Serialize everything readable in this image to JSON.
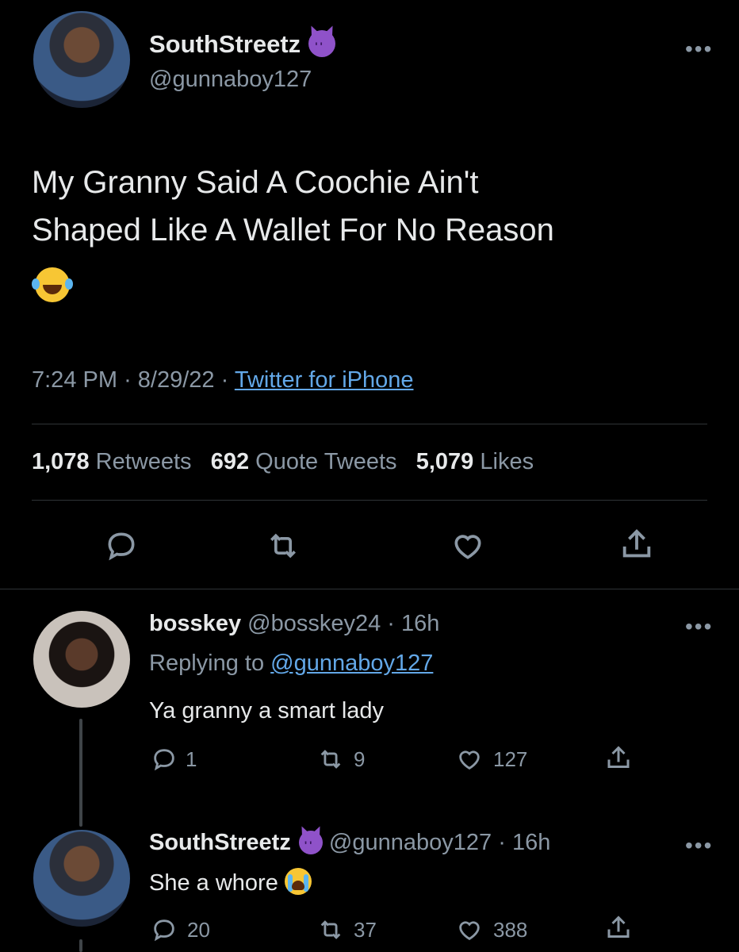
{
  "main_tweet": {
    "display_name": "SouthStreetz",
    "handle": "@gunnaboy127",
    "text_line1": "My Granny Said A Coochie Ain't",
    "text_line2": "Shaped Like A Wallet For No Reason",
    "time": "7:24 PM",
    "date": "8/29/22",
    "source": "Twitter for iPhone",
    "dot": "·",
    "stats": {
      "retweets_count": "1,078",
      "retweets_label": "Retweets",
      "quote_count": "692",
      "quote_label": "Quote Tweets",
      "likes_count": "5,079",
      "likes_label": "Likes"
    }
  },
  "reply_1": {
    "display_name": "bosskey",
    "handle": "@bosskey24",
    "time": "16h",
    "replying_prefix": "Replying to",
    "replying_to": "@gunnaboy127",
    "text": "Ya granny a smart lady",
    "replies": "1",
    "retweets": "9",
    "likes": "127"
  },
  "reply_2": {
    "display_name": "SouthStreetz",
    "handle": "@gunnaboy127",
    "time": "16h",
    "text": "She a whore",
    "replies": "20",
    "retweets": "37",
    "likes": "388"
  },
  "more_label": "•••",
  "colors": {
    "background": "#000000",
    "text": "#e7e9ea",
    "muted": "#8b98a5",
    "link": "#63a8e8",
    "divider": "#2f3336"
  }
}
